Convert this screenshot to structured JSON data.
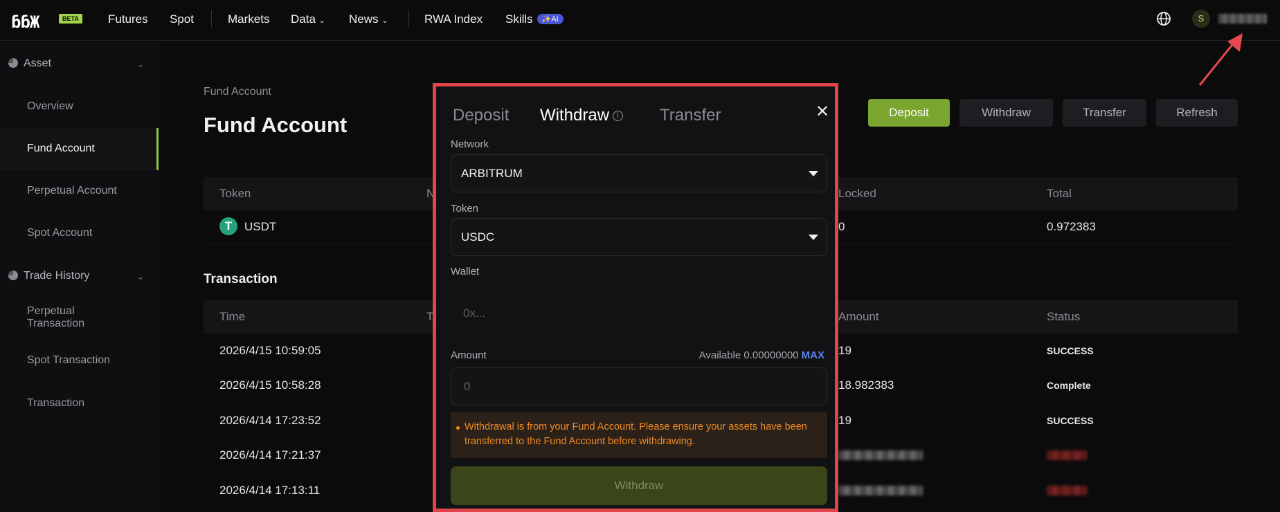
{
  "nav": {
    "logo": "ɓɓЖ",
    "beta": "BETA",
    "futures": "Futures",
    "spot": "Spot",
    "markets": "Markets",
    "data": "Data",
    "news": "News",
    "rwa_index": "RWA Index",
    "skills": "Skills",
    "ai_badge": "AI",
    "avatar_letter": "S"
  },
  "sidebar": {
    "asset_group": "Asset",
    "items": [
      "Overview",
      "Fund Account",
      "Perpetual Account",
      "Spot Account"
    ],
    "trade_history_group": "Trade History",
    "history_items": [
      "Perpetual Transaction",
      "Spot Transaction",
      "Transaction"
    ]
  },
  "page": {
    "breadcrumb": "Fund Account",
    "title": "Fund Account",
    "buttons": {
      "deposit": "Deposit",
      "withdraw": "Withdraw",
      "transfer": "Transfer",
      "refresh": "Refresh"
    },
    "balances_headers": [
      "Token",
      "N",
      "Locked",
      "Total"
    ],
    "balance_row": {
      "token": "USDT",
      "locked": "0",
      "total": "0.972383"
    },
    "transaction_title": "Transaction",
    "tx_headers": [
      "Time",
      "T",
      "Amount",
      "Status"
    ],
    "tx_rows": [
      {
        "time": "2026/4/15 10:59:05",
        "amount": "19",
        "status": "SUCCESS"
      },
      {
        "time": "2026/4/15 10:58:28",
        "amount": "18.982383",
        "status": "Complete"
      },
      {
        "time": "2026/4/14 17:23:52",
        "amount": "19",
        "status": "SUCCESS"
      },
      {
        "time": "2026/4/14 17:21:37",
        "amount": "",
        "status": ""
      },
      {
        "time": "2026/4/14 17:13:11",
        "amount": "",
        "status": ""
      }
    ]
  },
  "modal": {
    "tabs": {
      "deposit": "Deposit",
      "withdraw": "Withdraw",
      "transfer": "Transfer"
    },
    "active_tab": "Withdraw",
    "network_label": "Network",
    "network_value": "ARBITRUM",
    "token_label": "Token",
    "token_value": "USDC",
    "wallet_label": "Wallet",
    "wallet_placeholder": "0x...",
    "amount_label": "Amount",
    "available": "Available 0.00000000",
    "max": "MAX",
    "amount_placeholder": "0",
    "notice": "Withdrawal is from your Fund Account. Please ensure your assets have been transferred to the Fund Account before withdrawing.",
    "submit": "Withdraw"
  },
  "colors": {
    "accent_green": "#7aa52e",
    "highlight_border": "#e0454b",
    "warning": "#f08a24",
    "max_blue": "#5b86f5"
  }
}
